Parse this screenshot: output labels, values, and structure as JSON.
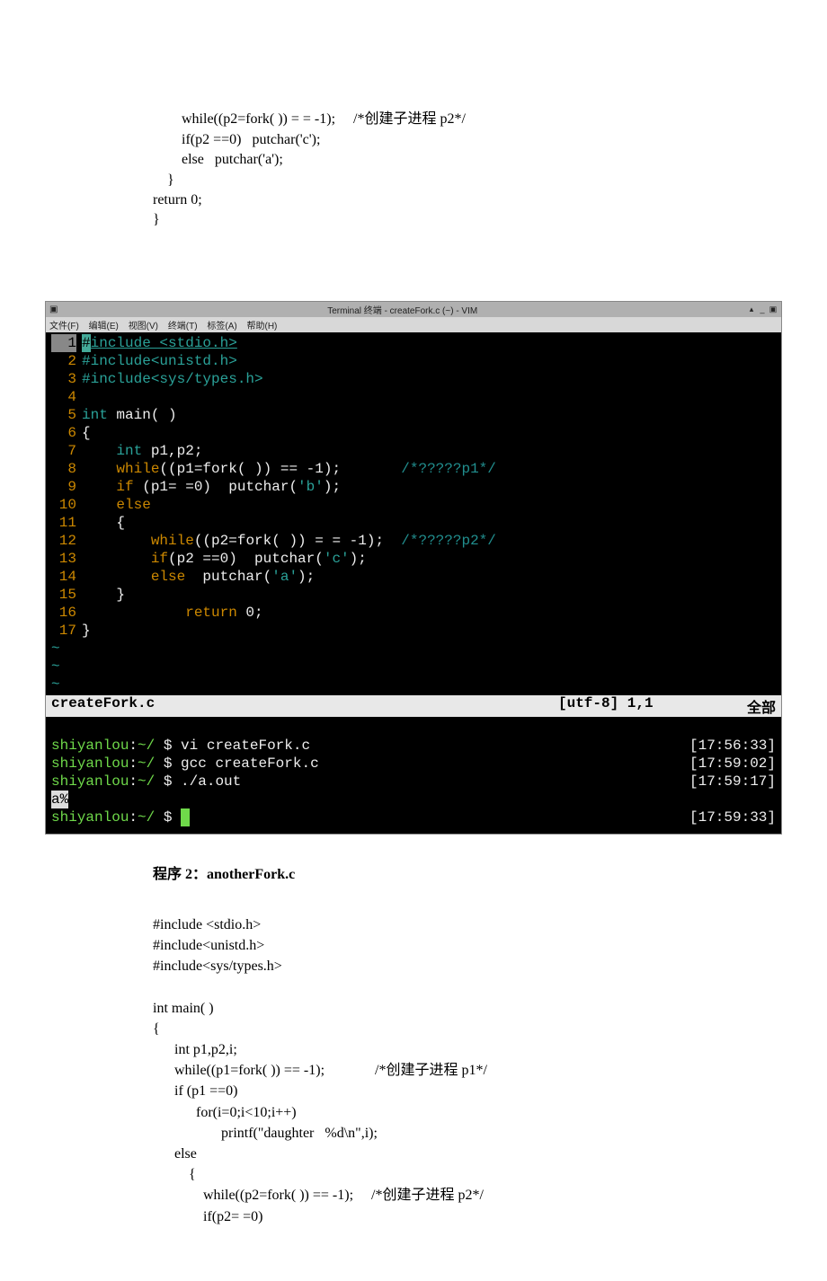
{
  "top_code": {
    "l1": "        while((p2=fork( )) = = -1);     /*创建子进程 p2*/",
    "l2": "        if(p2 ==0)   putchar('c');",
    "l3": "        else   putchar('a');",
    "l4": "    }",
    "l5": "return 0;",
    "l6": "}"
  },
  "terminal": {
    "title": "Terminal 终端 - createFork.c (~) - VIM",
    "menus": {
      "file": "文件(F)",
      "edit": "编辑(E)",
      "view": "视图(V)",
      "term": "终端(T)",
      "tabs": "标签(A)",
      "help": "帮助(H)"
    },
    "winbtns": {
      "min": "▴",
      "mid": "_",
      "close": "▣"
    }
  },
  "vim": {
    "lines": [
      {
        "n": "1",
        "pre": "#",
        "body": "include <stdio.h>"
      },
      {
        "n": "2",
        "txt": "#include<unistd.h>"
      },
      {
        "n": "3",
        "txt": "#include<sys/types.h>"
      },
      {
        "n": "4",
        "txt": ""
      },
      {
        "n": "5",
        "txt_int": "int",
        "txt_rest": " main( )"
      },
      {
        "n": "6",
        "txt": "{"
      },
      {
        "n": "7",
        "ind": "    ",
        "kw": "int",
        "rest": " p1,p2;"
      },
      {
        "n": "8",
        "ind": "    ",
        "kw": "while",
        "rest": "((p1=fork( )) == -1);       ",
        "com": "/*?????p1*/"
      },
      {
        "n": "9",
        "ind": "    ",
        "kw": "if",
        "rest": " (p1= =0)  putchar(",
        "str": "'b'",
        "rest2": ");"
      },
      {
        "n": "10",
        "ind": "    ",
        "kw": "else",
        "rest": ""
      },
      {
        "n": "11",
        "ind": "    ",
        "rest": "{"
      },
      {
        "n": "12",
        "ind": "        ",
        "kw": "while",
        "rest": "((p2=fork( )) = = -1);  ",
        "com": "/*?????p2*/"
      },
      {
        "n": "13",
        "ind": "        ",
        "kw": "if",
        "rest": "(p2 ==0)  putchar(",
        "str": "'c'",
        "rest2": ");"
      },
      {
        "n": "14",
        "ind": "        ",
        "kw": "else",
        "rest": "  putchar(",
        "str": "'a'",
        "rest2": ");"
      },
      {
        "n": "15",
        "ind": "    ",
        "rest": "}"
      },
      {
        "n": "16",
        "ind": "            ",
        "kw": "return",
        "rest": " 0;"
      },
      {
        "n": "17",
        "rest": "}"
      }
    ],
    "status": {
      "file": "createFork.c",
      "pos": "[utf-8] 1,1",
      "all": "全部"
    }
  },
  "shell": {
    "host": "shiyanlou",
    "path": "~/",
    "sym": " $ ",
    "rows": [
      {
        "cmd": "vi createFork.c",
        "time": "[17:56:33]"
      },
      {
        "cmd": "gcc createFork.c",
        "time": "[17:59:02]"
      },
      {
        "cmd": "./a.out",
        "time": "[17:59:17]"
      }
    ],
    "output": "a%",
    "prompt_time": "[17:59:33]"
  },
  "heading2": "程序 2：anotherFork.c",
  "bottom_code": {
    "l1": "#include <stdio.h>",
    "l2": "#include<unistd.h>",
    "l3": "#include<sys/types.h>",
    "l4": "",
    "l5": "int main( )",
    "l6": "{",
    "l7": "      int p1,p2,i;",
    "l8": "      while((p1=fork( )) == -1);              /*创建子进程 p1*/",
    "l9": "      if (p1 ==0)",
    "l10": "            for(i=0;i<10;i++)",
    "l11": "                   printf(\"daughter   %d\\n\",i);",
    "l12": "      else",
    "l13": "          {",
    "l14": "              while((p2=fork( )) == -1);     /*创建子进程 p2*/",
    "l15": "              if(p2= =0)"
  }
}
